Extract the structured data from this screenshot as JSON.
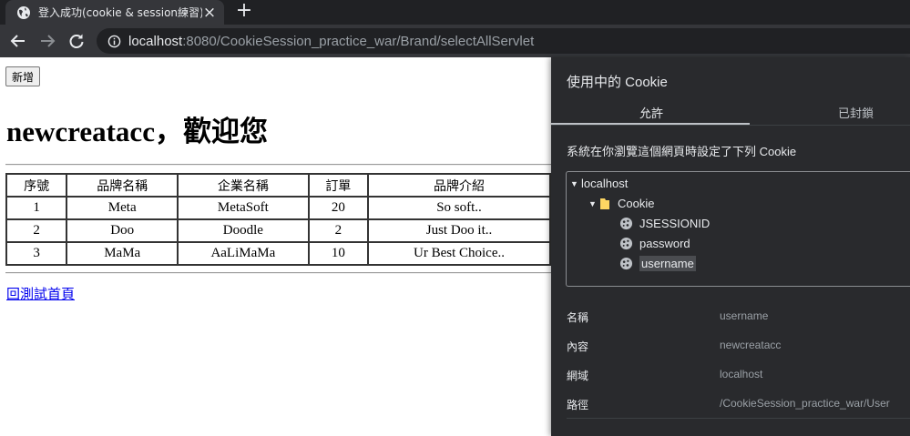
{
  "browser": {
    "tab": {
      "title": "登入成功(cookie & session練習)"
    },
    "omnibox": {
      "host": "localhost",
      "rest": ":8080/CookieSession_practice_war/Brand/selectAllServlet"
    }
  },
  "page": {
    "add_button": "新增",
    "welcome": "newcreatacc，歡迎您",
    "table": {
      "headers": [
        "序號",
        "品牌名稱",
        "企業名稱",
        "訂單",
        "品牌介紹"
      ],
      "rows": [
        [
          "1",
          "Meta",
          "MetaSoft",
          "20",
          "So soft.."
        ],
        [
          "2",
          "Doo",
          "Doodle",
          "2",
          "Just Doo it.."
        ],
        [
          "3",
          "MaMa",
          "AaLiMaMa",
          "10",
          "Ur Best Choice.."
        ]
      ]
    },
    "back_link": "回測試首頁"
  },
  "cookie_dialog": {
    "title": "使用中的 Cookie",
    "tabs": {
      "allowed": "允許",
      "blocked": "已封鎖"
    },
    "description": "系統在你瀏覽這個網頁時設定了下列 Cookie",
    "tree": {
      "site": "localhost",
      "folder": "Cookie",
      "cookies": [
        "JSESSIONID",
        "password",
        "username"
      ],
      "selected": "username"
    },
    "details": [
      {
        "key": "名稱",
        "value": "username"
      },
      {
        "key": "內容",
        "value": "newcreatacc"
      },
      {
        "key": "網域",
        "value": "localhost"
      },
      {
        "key": "路徑",
        "value": "/CookieSession_practice_war/User"
      }
    ]
  },
  "colors": {
    "link": "#0000ee",
    "dialog_bg": "#292a2d",
    "chrome_dark": "#202124",
    "folder_yellow": "#fdd663"
  },
  "icons": {
    "tab_favicon": "globe-icon",
    "tab_close": "close-icon",
    "new_tab": "plus-icon",
    "back": "back-arrow-icon",
    "forward": "forward-arrow-icon",
    "reload": "reload-icon",
    "site_info": "info-icon",
    "folder": "folder-icon",
    "cookie": "cookie-icon"
  }
}
